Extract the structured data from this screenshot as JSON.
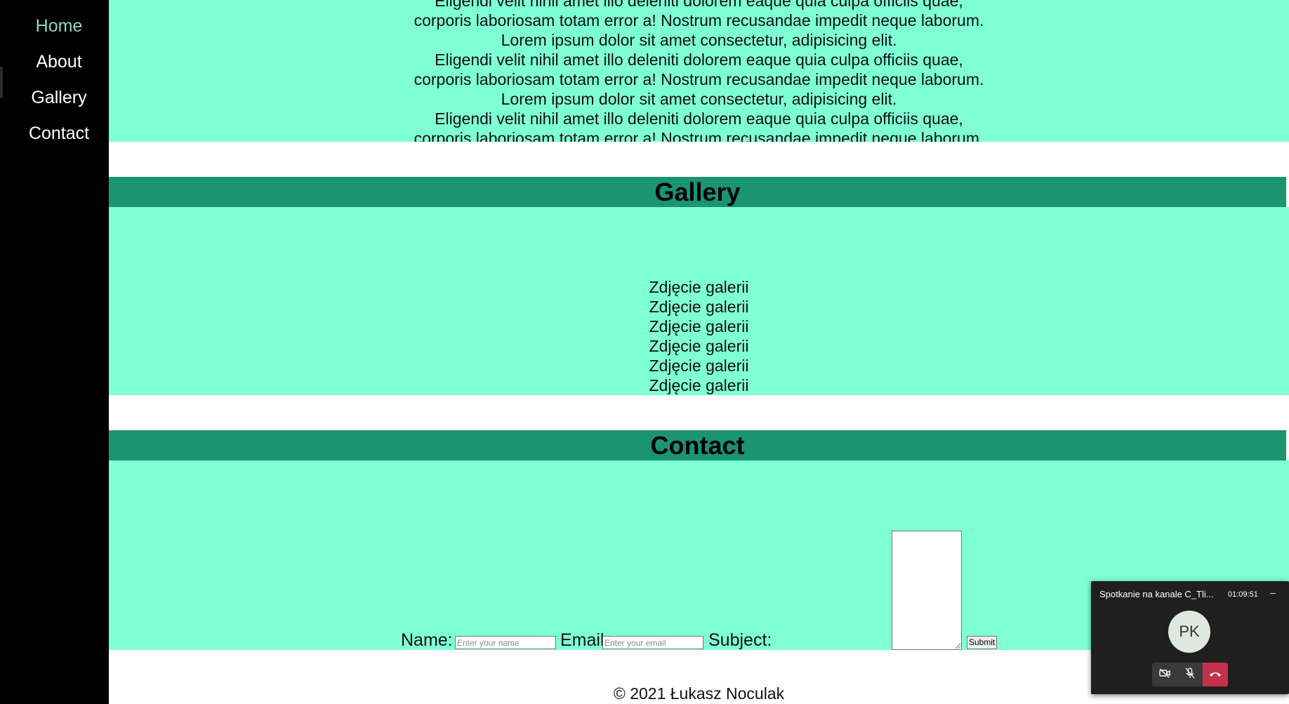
{
  "nav": {
    "items": [
      {
        "label": "Home",
        "active": true
      },
      {
        "label": "About",
        "active": false
      },
      {
        "label": "Gallery",
        "active": false
      },
      {
        "label": "Contact",
        "active": false
      }
    ]
  },
  "about": {
    "lines": [
      "Eligendi velit nihil amet illo deleniti dolorem eaque quia culpa officiis quae,",
      "corporis laboriosam totam error a! Nostrum recusandae impedit neque laborum.",
      "Lorem ipsum dolor sit amet consectetur, adipisicing elit.",
      "Eligendi velit nihil amet illo deleniti dolorem eaque quia culpa officiis quae,",
      "corporis laboriosam totam error a! Nostrum recusandae impedit neque laborum.",
      "Lorem ipsum dolor sit amet consectetur, adipisicing elit.",
      "Eligendi velit nihil amet illo deleniti dolorem eaque quia culpa officiis quae,",
      "corporis laboriosam totam error a! Nostrum recusandae impedit neque laborum."
    ]
  },
  "gallery": {
    "heading": "Gallery",
    "items": [
      "Zdjęcie galerii",
      "Zdjęcie galerii",
      "Zdjęcie galerii",
      "Zdjęcie galerii",
      "Zdjęcie galerii",
      "Zdjęcie galerii"
    ]
  },
  "contact": {
    "heading": "Contact",
    "name_label": "Name:",
    "name_placeholder": "Enter your name",
    "email_label": "Email:",
    "email_placeholder": "Enter your email",
    "subject_label": "Subject:",
    "submit_label": "Submit"
  },
  "footer": {
    "text": "© 2021 Łukasz Noculak"
  },
  "meeting": {
    "title": "Spotkanie na kanale C_Tli...",
    "timer": "01:09:51",
    "minimize": "–",
    "avatar_initials": "PK",
    "icons": [
      "camera-off-icon",
      "mic-off-icon",
      "hang-up-icon"
    ]
  },
  "colors": {
    "sidebar_bg": "#000000",
    "nav_active": "#8fd9b6",
    "section_bg": "#7fffd4",
    "header_bg": "#1b9470",
    "hangup": "#c4314b"
  }
}
